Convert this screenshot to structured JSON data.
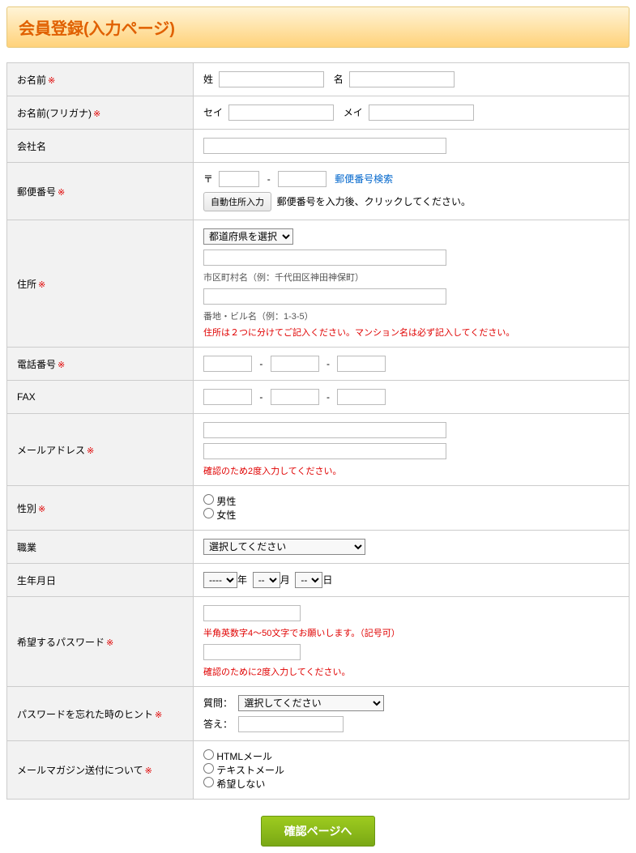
{
  "title": "会員登録(入力ページ)",
  "labels": {
    "name": "お名前",
    "kana": "お名前(フリガナ)",
    "company": "会社名",
    "zip": "郵便番号",
    "address": "住所",
    "tel": "電話番号",
    "fax": "FAX",
    "email": "メールアドレス",
    "gender": "性別",
    "job": "職業",
    "birth": "生年月日",
    "password": "希望するパスワード",
    "hint": "パスワードを忘れた時のヒント",
    "mailmag": "メールマガジン送付について"
  },
  "name": {
    "sei": "姓",
    "mei": "名"
  },
  "kana": {
    "sei": "セイ",
    "mei": "メイ"
  },
  "zip": {
    "mark": "〒",
    "sep": "-",
    "search": "郵便番号検索",
    "autoBtn": "自動住所入力",
    "autoNote": "郵便番号を入力後、クリックしてください。"
  },
  "address": {
    "prefSelect": "都道府県を選択",
    "cityNote": "市区町村名（例：千代田区神田神保町）",
    "streetNote": "番地・ビル名（例：1-3-5）",
    "warn": "住所は２つに分けてご記入ください。マンション名は必ず記入してください。"
  },
  "tel": {
    "sep": "-"
  },
  "email": {
    "note": "確認のため2度入力してください。"
  },
  "gender": {
    "male": "男性",
    "female": "女性"
  },
  "job": {
    "select": "選択してください"
  },
  "birth": {
    "yearDef": "----",
    "monDef": "--",
    "dayDef": "--",
    "y": "年",
    "m": "月",
    "d": "日"
  },
  "password": {
    "note1": "半角英数字4〜50文字でお願いします。（記号可）",
    "note2": "確認のために2度入力してください。"
  },
  "hint": {
    "q": "質問：",
    "a": "答え：",
    "select": "選択してください"
  },
  "mailmag": {
    "html": "HTMLメール",
    "text": "テキストメール",
    "none": "希望しない"
  },
  "submit": "確認ページへ",
  "reqMark": "※"
}
